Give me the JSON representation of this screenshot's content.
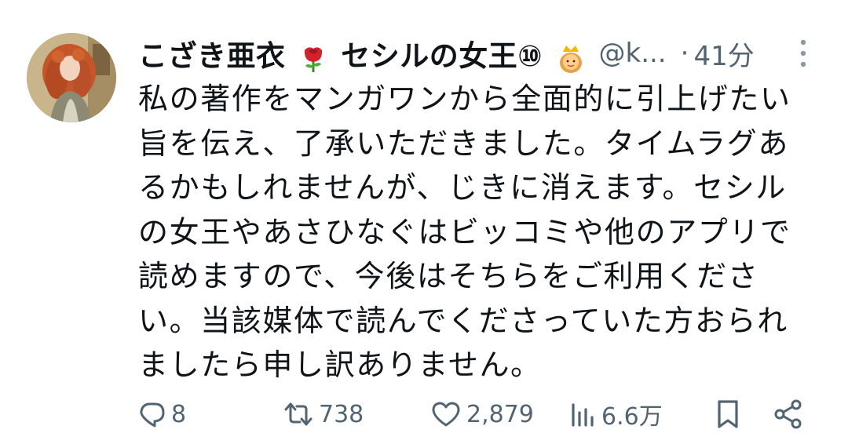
{
  "tweet": {
    "display_name_part1": "こざき亜衣",
    "display_name_part2": "セシルの女王⑩",
    "handle": "@k...",
    "separator": "·",
    "time": "41分",
    "body_lines": [
      "私の著作をマンガワンから全面的に引上げたい",
      "旨を伝え、了承いただきました。タイムラグあ",
      "るかもしれませんが、じきに消えます。セシル",
      "の女王やあさひなぐはビッコミや他のアプリで",
      "読めますので、今後はそちらをご利用くださ",
      "い。当該媒体で読んでくださっていた方おられ",
      "ましたら申し訳ありません。"
    ]
  },
  "actions": {
    "replies": "8",
    "retweets": "738",
    "likes": "2,879",
    "views": "6.6万"
  },
  "icons": {
    "name_emoji_1": "rose-icon",
    "name_emoji_2": "princess-crown-icon",
    "reply": "reply-icon",
    "retweet": "retweet-icon",
    "like": "heart-icon",
    "views": "views-icon",
    "bookmark": "bookmark-icon",
    "share": "share-icon",
    "more": "more-vertical-icon"
  },
  "colors": {
    "text": "#0f1419",
    "secondary": "#536471",
    "background": "#ffffff"
  }
}
